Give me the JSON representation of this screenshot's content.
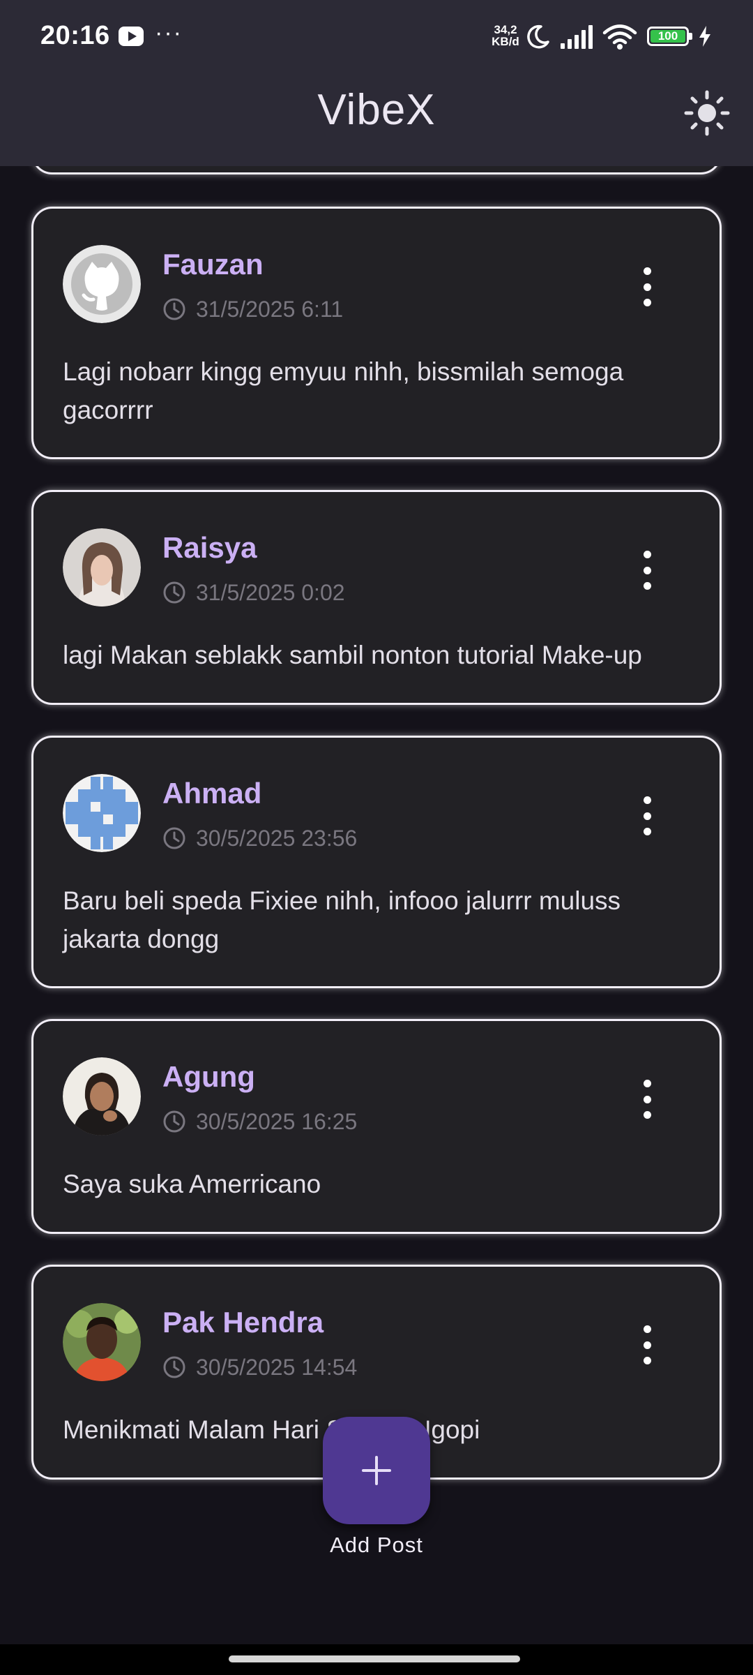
{
  "status_bar": {
    "time": "20:16",
    "more": "···",
    "network_speed_value": "34,2",
    "network_speed_unit": "KB/d",
    "battery": "100"
  },
  "app_bar": {
    "title": "VibeX",
    "theme_icon": "sun-icon"
  },
  "posts": [
    {
      "name": "Fauzan",
      "time": "31/5/2025 6:11",
      "text": "Lagi nobarr kingg emyuu nihh, bissmilah semoga gacorrrr",
      "avatar": "github-octocat"
    },
    {
      "name": "Raisya",
      "time": "31/5/2025 0:02",
      "text": "lagi Makan seblakk sambil nonton tutorial Make-up",
      "avatar": "photo-woman"
    },
    {
      "name": "Ahmad",
      "time": "30/5/2025 23:56",
      "text": "Baru beli speda Fixiee nihh, infooo jalurrr muluss jakarta dongg",
      "avatar": "identicon-blue"
    },
    {
      "name": "Agung",
      "time": "30/5/2025 16:25",
      "text": "Saya suka Amerricano",
      "avatar": "photo-woman-smiling"
    },
    {
      "name": "Pak Hendra",
      "time": "30/5/2025 14:54",
      "text": "Menikmati Malam Hari Sambil Ngopi",
      "avatar": "photo-man"
    }
  ],
  "fab": {
    "label": "Add Post",
    "icon": "plus-icon"
  },
  "colors": {
    "background": "#14121a",
    "app_bar": "#2c2a36",
    "card": "#222125",
    "name": "#cbb0f4",
    "fab": "#4f3892"
  }
}
